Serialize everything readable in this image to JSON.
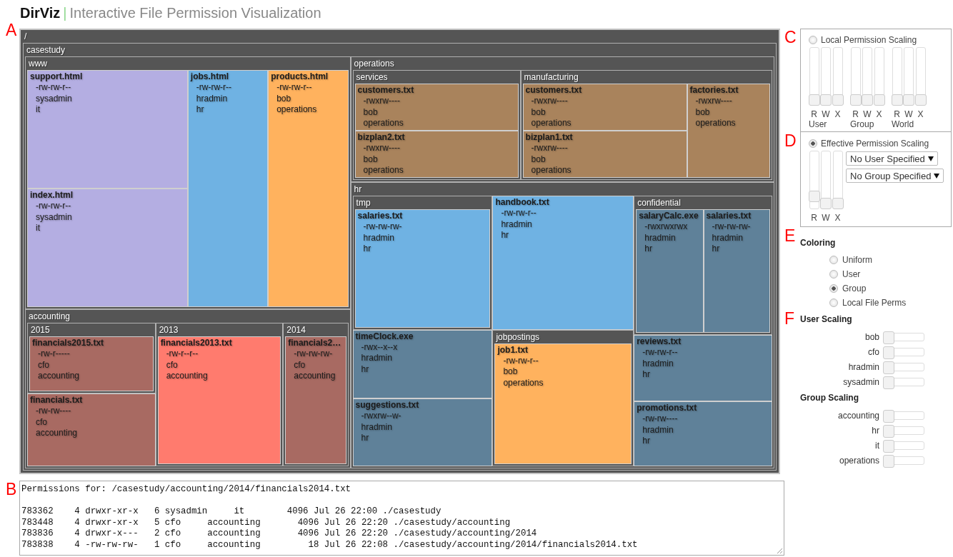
{
  "header": {
    "title": "DirViz",
    "separator": "|",
    "subtitle": "Interactive File Permission Visualization"
  },
  "treemap": {
    "marker": "A",
    "root": {
      "kind": "dir",
      "name": "/",
      "children": [
        {
          "kind": "dir",
          "name": "casestudy",
          "children": [
            {
              "kind": "dir",
              "name": "www",
              "children": [
                {
                  "kind": "file",
                  "name": "support.html",
                  "perms": "-rw-rw-r--",
                  "owner": "sysadmin",
                  "group": "it",
                  "color": "#b4aee2"
                },
                {
                  "kind": "file",
                  "name": "index.html",
                  "perms": "-rw-rw-r--",
                  "owner": "sysadmin",
                  "group": "it",
                  "color": "#b4aee2"
                },
                {
                  "kind": "file",
                  "name": "jobs.html",
                  "perms": "-rw-rw-r--",
                  "owner": "hradmin",
                  "group": "hr",
                  "color": "#6fb2e3"
                },
                {
                  "kind": "file",
                  "name": "products.html",
                  "perms": "-rw-rw-r--",
                  "owner": "bob",
                  "group": "operations",
                  "color": "#ffb25e"
                }
              ]
            },
            {
              "kind": "dir",
              "name": "accounting",
              "children": [
                {
                  "kind": "dir",
                  "name": "2015",
                  "children": [
                    {
                      "kind": "file",
                      "name": "financials2015.txt",
                      "perms": "-rw-r-----",
                      "owner": "cfo",
                      "group": "accounting",
                      "color": "#a86a62"
                    }
                  ]
                },
                {
                  "kind": "file",
                  "name": "financials.txt",
                  "perms": "-rw-rw----",
                  "owner": "cfo",
                  "group": "accounting",
                  "color": "#a86a62"
                },
                {
                  "kind": "dir",
                  "name": "2013",
                  "children": [
                    {
                      "kind": "file",
                      "name": "financials2013.txt",
                      "perms": "-rw-r--r--",
                      "owner": "cfo",
                      "group": "accounting",
                      "color": "#ff7b6e"
                    }
                  ]
                },
                {
                  "kind": "dir",
                  "name": "2014",
                  "children": [
                    {
                      "kind": "file",
                      "name": "financials2…",
                      "perms": "-rw-rw-rw-",
                      "owner": "cfo",
                      "group": "accounting",
                      "color": "#a86a62"
                    }
                  ]
                }
              ]
            },
            {
              "kind": "dir",
              "name": "operations",
              "children": [
                {
                  "kind": "dir",
                  "name": "services",
                  "children": [
                    {
                      "kind": "file",
                      "name": "customers.txt",
                      "perms": "-rwxrw----",
                      "owner": "bob",
                      "group": "operations",
                      "color": "#a9835c"
                    },
                    {
                      "kind": "file",
                      "name": "bizplan2.txt",
                      "perms": "-rwxrw----",
                      "owner": "bob",
                      "group": "operations",
                      "color": "#a9835c"
                    }
                  ]
                },
                {
                  "kind": "dir",
                  "name": "manufacturing",
                  "children": [
                    {
                      "kind": "file",
                      "name": "customers.txt",
                      "perms": "-rwxrw----",
                      "owner": "bob",
                      "group": "operations",
                      "color": "#a9835c"
                    },
                    {
                      "kind": "file",
                      "name": "bizplan1.txt",
                      "perms": "-rwxrw----",
                      "owner": "bob",
                      "group": "operations",
                      "color": "#a9835c"
                    },
                    {
                      "kind": "file",
                      "name": "factories.txt",
                      "perms": "-rwxrw----",
                      "owner": "bob",
                      "group": "operations",
                      "color": "#a9835c"
                    }
                  ]
                }
              ]
            },
            {
              "kind": "dir",
              "name": "hr",
              "children": [
                {
                  "kind": "dir",
                  "name": "tmp",
                  "children": [
                    {
                      "kind": "file",
                      "name": "salaries.txt",
                      "perms": "-rw-rw-rw-",
                      "owner": "hradmin",
                      "group": "hr",
                      "color": "#6fb2e3"
                    }
                  ]
                },
                {
                  "kind": "file",
                  "name": "timeClock.exe",
                  "perms": "-rwx--x--x",
                  "owner": "hradmin",
                  "group": "hr",
                  "color": "#5f8199"
                },
                {
                  "kind": "file",
                  "name": "suggestions.txt",
                  "perms": "-rwxrw--w-",
                  "owner": "hradmin",
                  "group": "hr",
                  "color": "#5f8199"
                },
                {
                  "kind": "file",
                  "name": "handbook.txt",
                  "perms": "-rw-rw-r--",
                  "owner": "hradmin",
                  "group": "hr",
                  "color": "#6fb2e3"
                },
                {
                  "kind": "dir",
                  "name": "jobpostings",
                  "children": [
                    {
                      "kind": "file",
                      "name": "job1.txt",
                      "perms": "-rw-rw-r--",
                      "owner": "bob",
                      "group": "operations",
                      "color": "#ffb25e"
                    }
                  ]
                },
                {
                  "kind": "dir",
                  "name": "confidential",
                  "children": [
                    {
                      "kind": "file",
                      "name": "salaryCalc.exe",
                      "perms": "-rwxrwxrwx",
                      "owner": "hradmin",
                      "group": "hr",
                      "color": "#5f8199"
                    },
                    {
                      "kind": "file",
                      "name": "salaries.txt",
                      "perms": "-rw-rw-rw-",
                      "owner": "hradmin",
                      "group": "hr",
                      "color": "#5f8199"
                    }
                  ]
                },
                {
                  "kind": "file",
                  "name": "reviews.txt",
                  "perms": "-rw-rw-r--",
                  "owner": "hradmin",
                  "group": "hr",
                  "color": "#5f8199"
                },
                {
                  "kind": "file",
                  "name": "promotions.txt",
                  "perms": "-rw-rw----",
                  "owner": "hradmin",
                  "group": "hr",
                  "color": "#5f8199"
                }
              ]
            }
          ]
        }
      ]
    }
  },
  "console": {
    "marker": "B",
    "heading": "Permissions for: /casestudy/accounting/2014/financials2014.txt",
    "rows": [
      "783362    4 drwxr-xr-x   6 sysadmin     it        4096 Jul 26 22:00 ./casestudy",
      "783448    4 drwxr-xr-x   5 cfo     accounting       4096 Jul 26 22:20 ./casestudy/accounting",
      "783836    4 drwxr-x---   2 cfo     accounting       4096 Jul 26 22:20 ./casestudy/accounting/2014",
      "783838    4 -rw-rw-rw-   1 cfo     accounting         18 Jul 26 22:08 ./casestudy/accounting/2014/financials2014.txt"
    ]
  },
  "local_scaling": {
    "marker": "C",
    "label": "Local Permission Scaling",
    "selected": false,
    "groups": [
      {
        "label": "User",
        "sliders": [
          {
            "label": "R",
            "level": 0
          },
          {
            "label": "W",
            "level": 0
          },
          {
            "label": "X",
            "level": 0
          }
        ]
      },
      {
        "label": "Group",
        "sliders": [
          {
            "label": "R",
            "level": 0
          },
          {
            "label": "W",
            "level": 0
          },
          {
            "label": "X",
            "level": 0
          }
        ]
      },
      {
        "label": "World",
        "sliders": [
          {
            "label": "R",
            "level": 0
          },
          {
            "label": "W",
            "level": 0
          },
          {
            "label": "X",
            "level": 0
          }
        ]
      }
    ]
  },
  "effective_scaling": {
    "marker": "D",
    "label": "Effective Permission Scaling",
    "selected": true,
    "sliders": [
      {
        "label": "R",
        "level": 0.15
      },
      {
        "label": "W",
        "level": 0
      },
      {
        "label": "X",
        "level": 0
      }
    ],
    "selects": [
      {
        "value": "No User Specified"
      },
      {
        "value": "No Group Specified"
      }
    ]
  },
  "coloring": {
    "marker": "E",
    "title": "Coloring",
    "options": [
      {
        "label": "Uniform",
        "selected": false
      },
      {
        "label": "User",
        "selected": false
      },
      {
        "label": "Group",
        "selected": true
      },
      {
        "label": "Local File Perms",
        "selected": false
      }
    ]
  },
  "user_scaling": {
    "marker": "F",
    "title": "User Scaling",
    "sliders": [
      {
        "label": "bob",
        "level": 0
      },
      {
        "label": "cfo",
        "level": 0
      },
      {
        "label": "hradmin",
        "level": 0
      },
      {
        "label": "sysadmin",
        "level": 0
      }
    ]
  },
  "group_scaling": {
    "title": "Group Scaling",
    "sliders": [
      {
        "label": "accounting",
        "level": 0
      },
      {
        "label": "hr",
        "level": 0
      },
      {
        "label": "it",
        "level": 0
      },
      {
        "label": "operations",
        "level": 0
      }
    ]
  }
}
